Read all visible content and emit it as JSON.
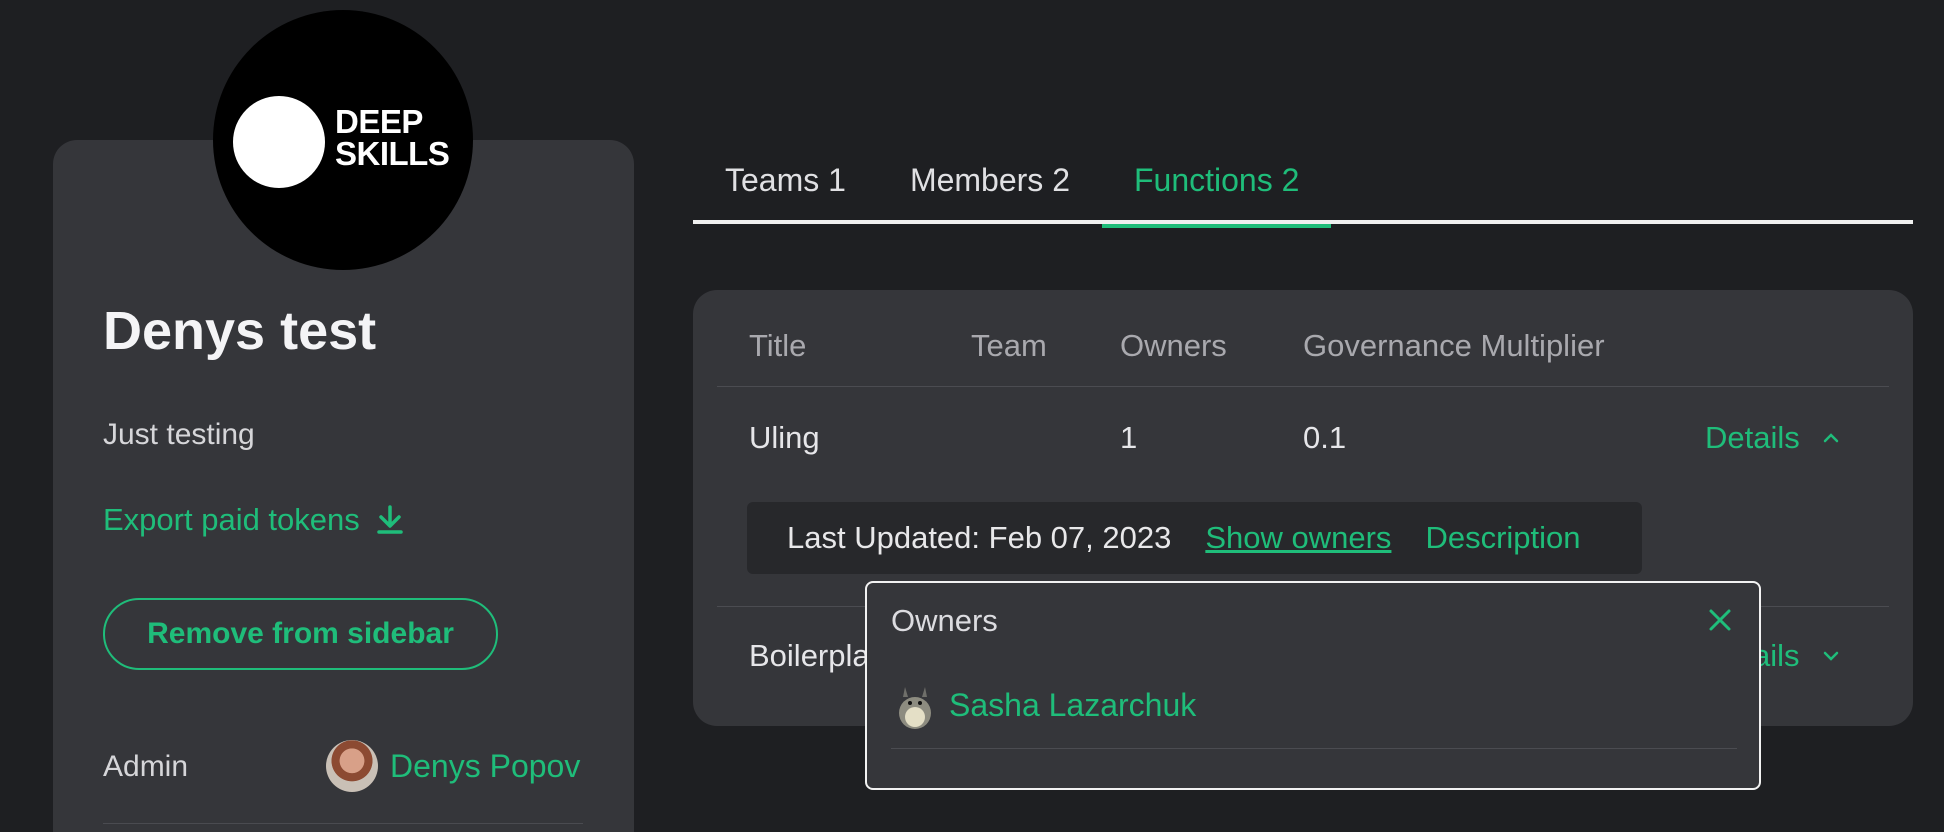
{
  "profile": {
    "logo_line1": "DEEP",
    "logo_line2": "SKILLS",
    "name": "Denys test",
    "description": "Just testing",
    "export_label": "Export paid tokens",
    "remove_label": "Remove from sidebar",
    "admin_label": "Admin",
    "admin_name": "Denys Popov"
  },
  "tabs": [
    {
      "label": "Teams 1"
    },
    {
      "label": "Members 2"
    },
    {
      "label": "Functions 2",
      "active": true
    }
  ],
  "table": {
    "columns": [
      "Title",
      "Team",
      "Owners",
      "Governance Multiplier"
    ],
    "rows": [
      {
        "title": "Uling",
        "team": "",
        "owners": "1",
        "multiplier": "0.1",
        "action": "Details",
        "expanded": true
      },
      {
        "title": "Boilerpla",
        "team": "",
        "owners": "",
        "multiplier": "",
        "action": "ails",
        "expanded": false
      }
    ],
    "expanded": {
      "last_updated": "Last Updated: Feb 07, 2023",
      "show_owners": "Show owners",
      "description": "Description"
    }
  },
  "owners_popup": {
    "title": "Owners",
    "owners": [
      {
        "name": "Sasha Lazarchuk"
      }
    ]
  },
  "colors": {
    "background": "#1e1f22",
    "card": "#35363a",
    "accent": "#1fbd7a"
  }
}
